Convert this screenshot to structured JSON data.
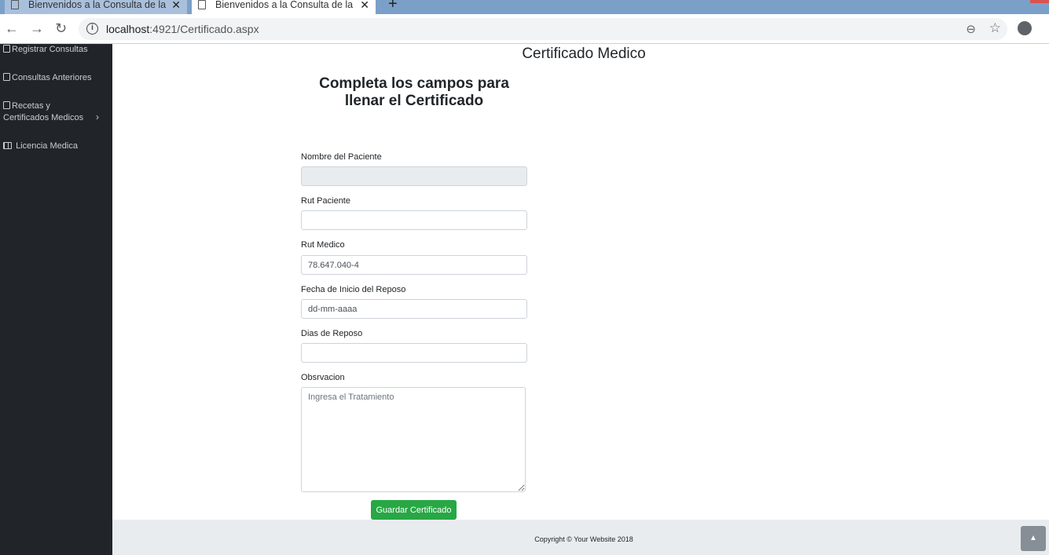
{
  "browser": {
    "tabs": [
      {
        "title": "Bienvenidos a la Consulta de la D",
        "active": false
      },
      {
        "title": "Bienvenidos a la Consulta de la D",
        "active": true
      }
    ],
    "url_host": "localhost",
    "url_rest": ":4921/Certificado.aspx"
  },
  "sidebar": {
    "items": [
      {
        "label": "Registrar Consultas",
        "icon": "clipboard-icon"
      },
      {
        "label": "Consultas Anteriores",
        "icon": "clipboard-icon"
      },
      {
        "label": "Recetas y Certificados Medicos",
        "icon": "clipboard-icon"
      },
      {
        "label": "Licencia Medica",
        "icon": "table-icon"
      }
    ]
  },
  "page": {
    "title": "Certificado Medico",
    "form_title": "Completa los campos para llenar el Certificado"
  },
  "form": {
    "nombre_label": "Nombre del Paciente",
    "nombre_value": "",
    "rut_paciente_label": "Rut Paciente",
    "rut_paciente_value": "",
    "rut_medico_label": "Rut Medico",
    "rut_medico_value": "78.647.040-4",
    "fecha_label": "Fecha de Inicio del Reposo",
    "fecha_value": "dd-mm-aaaa",
    "dias_label": "Dias de Reposo",
    "dias_value": "",
    "obs_label": "Obsrvacion",
    "obs_placeholder": "Ingresa el Tratamiento",
    "save_label": "Guardar Certificado"
  },
  "footer": {
    "copyright": "Copyright © Your Website 2018"
  }
}
